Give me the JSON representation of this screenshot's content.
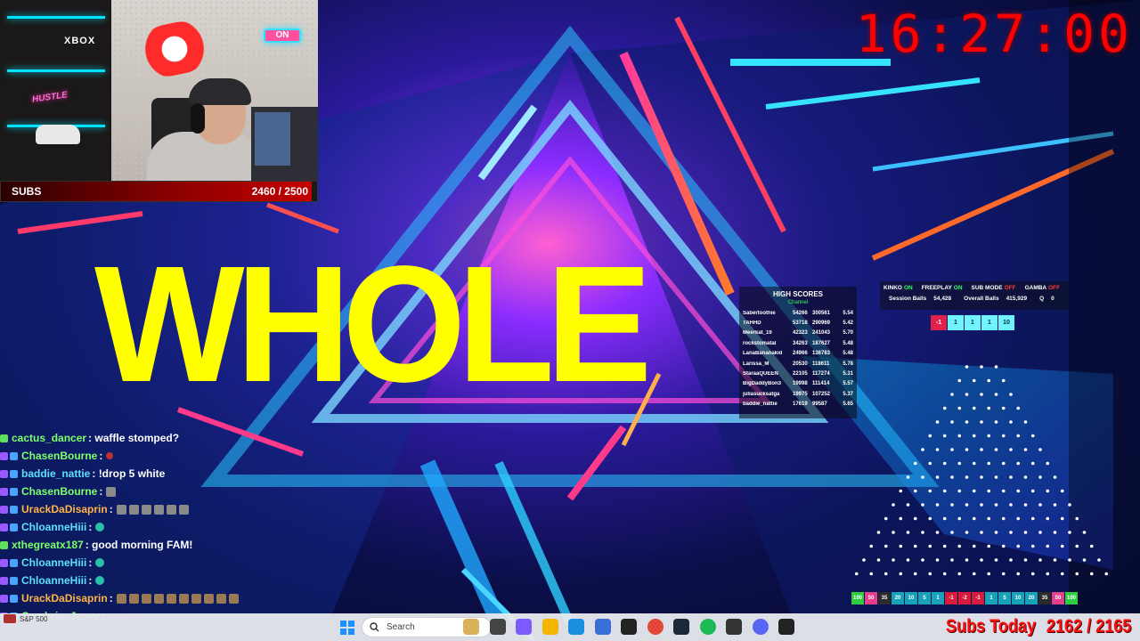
{
  "webcam": {
    "xbox_text": "XBOX",
    "neon_text": "HUSTLE",
    "on_sign": "ON"
  },
  "subs_goal": {
    "label": "SUBS",
    "count": "2460 / 2500",
    "progress": 0.984
  },
  "clock": {
    "time": "16:27:00"
  },
  "main_word": "WHOLE",
  "high_scores": {
    "title": "HIGH SCORES",
    "subtitle": "Channel",
    "rows": [
      {
        "name": "Sabertoothie",
        "a": "54266",
        "b": "300561",
        "c": "5.54"
      },
      {
        "name": "TAHHD",
        "a": "53718",
        "b": "290969",
        "c": "5.42"
      },
      {
        "name": "Meerkat_19",
        "a": "42323",
        "b": "241043",
        "c": "5.70"
      },
      {
        "name": "rockstomatal",
        "a": "34263",
        "b": "187627",
        "c": "5.48"
      },
      {
        "name": "LanaBananakid",
        "a": "24966",
        "b": "136783",
        "c": "5.48"
      },
      {
        "name": "Larissa_M",
        "a": "20530",
        "b": "118611",
        "c": "5.78"
      },
      {
        "name": "StaraaQUEEN",
        "a": "22105",
        "b": "117274",
        "c": "5.31"
      },
      {
        "name": "BigDaddyBon3",
        "a": "19998",
        "b": "111414",
        "c": "5.57"
      },
      {
        "name": "juliasucksatga",
        "a": "19975",
        "b": "107252",
        "c": "5.37"
      },
      {
        "name": "baddie_nattie",
        "a": "17619",
        "b": "99587",
        "c": "5.65"
      }
    ]
  },
  "status": {
    "modes": [
      {
        "label": "KINKO",
        "state": "ON"
      },
      {
        "label": "FREEPLAY",
        "state": "ON"
      },
      {
        "label": "SUB MODE",
        "state": "OFF"
      },
      {
        "label": "GAMBA",
        "state": "OFF"
      }
    ],
    "session_balls_label": "Session Balls",
    "session_balls": "54,428",
    "overall_balls_label": "Overall Balls",
    "overall_balls": "415,929",
    "q_label": "Q",
    "q_value": "0",
    "bets": [
      "-1",
      "1",
      "1",
      "1",
      "10"
    ]
  },
  "chips": [
    {
      "label": "100",
      "color": "#2ecc40"
    },
    {
      "label": "50",
      "color": "#e83e8c"
    },
    {
      "label": "35",
      "color": "#2b2b2b"
    },
    {
      "label": "20",
      "color": "#17a2b8"
    },
    {
      "label": "10",
      "color": "#17a2b8"
    },
    {
      "label": "5",
      "color": "#17a2b8"
    },
    {
      "label": "1",
      "color": "#17a2b8"
    },
    {
      "label": "-1",
      "color": "#d81b3a"
    },
    {
      "label": "-2",
      "color": "#d81b3a"
    },
    {
      "label": "-1",
      "color": "#d81b3a"
    },
    {
      "label": "1",
      "color": "#17a2b8"
    },
    {
      "label": "5",
      "color": "#17a2b8"
    },
    {
      "label": "10",
      "color": "#17a2b8"
    },
    {
      "label": "20",
      "color": "#17a2b8"
    },
    {
      "label": "35",
      "color": "#2b2b2b"
    },
    {
      "label": "50",
      "color": "#e83e8c"
    },
    {
      "label": "100",
      "color": "#2ecc40"
    }
  ],
  "chat": [
    {
      "user": "cactus_dancer",
      "color": "#7cff6b",
      "msg": ": waffle stomped?",
      "emotes": []
    },
    {
      "user": "ChasenBourne",
      "color": "#7cff6b",
      "msg": ":",
      "emotes": [
        "red"
      ]
    },
    {
      "user": "baddie_nattie",
      "color": "#5be0ff",
      "msg": ": !drop 5 white",
      "emotes": []
    },
    {
      "user": "ChasenBourne",
      "color": "#7cff6b",
      "msg": ":",
      "emotes": [
        "grey"
      ]
    },
    {
      "user": "UrackDaDisaprin",
      "color": "#ffb347",
      "msg": ":",
      "emotes": [
        "grey",
        "grey",
        "grey",
        "grey",
        "grey",
        "grey"
      ]
    },
    {
      "user": "ChloanneHiii",
      "color": "#5be0ff",
      "msg": ":",
      "emotes": [
        "cyan"
      ]
    },
    {
      "user": "xthegreatx187",
      "color": "#7cff6b",
      "msg": ": good morning FAM!",
      "emotes": []
    },
    {
      "user": "ChloanneHiii",
      "color": "#5be0ff",
      "msg": ":",
      "emotes": [
        "cyan"
      ]
    },
    {
      "user": "ChloanneHiii",
      "color": "#5be0ff",
      "msg": ":",
      "emotes": [
        "cyan"
      ]
    },
    {
      "user": "UrackDaDisaprin",
      "color": "#ffb347",
      "msg": ":",
      "emotes": [
        "brown",
        "brown",
        "brown",
        "brown",
        "brown",
        "brown",
        "brown",
        "brown",
        "brown",
        "brown"
      ]
    },
    {
      "user": "Cambrie_Jayyy",
      "color": "#7cff6b",
      "msg": ":",
      "emotes": []
    }
  ],
  "taskbar": {
    "weather_label": "S&P 500",
    "search_placeholder": "Search",
    "apps": [
      "file-explorer-icon",
      "task-view-icon",
      "copilot-icon",
      "folder-icon",
      "edge-icon",
      "store-icon",
      "media-icon",
      "chrome-icon",
      "steam-icon",
      "spotify-icon",
      "terminal-icon",
      "discord-icon",
      "obs-icon"
    ]
  },
  "subs_today": {
    "label": "Subs Today",
    "value": "2162 / 2165"
  }
}
